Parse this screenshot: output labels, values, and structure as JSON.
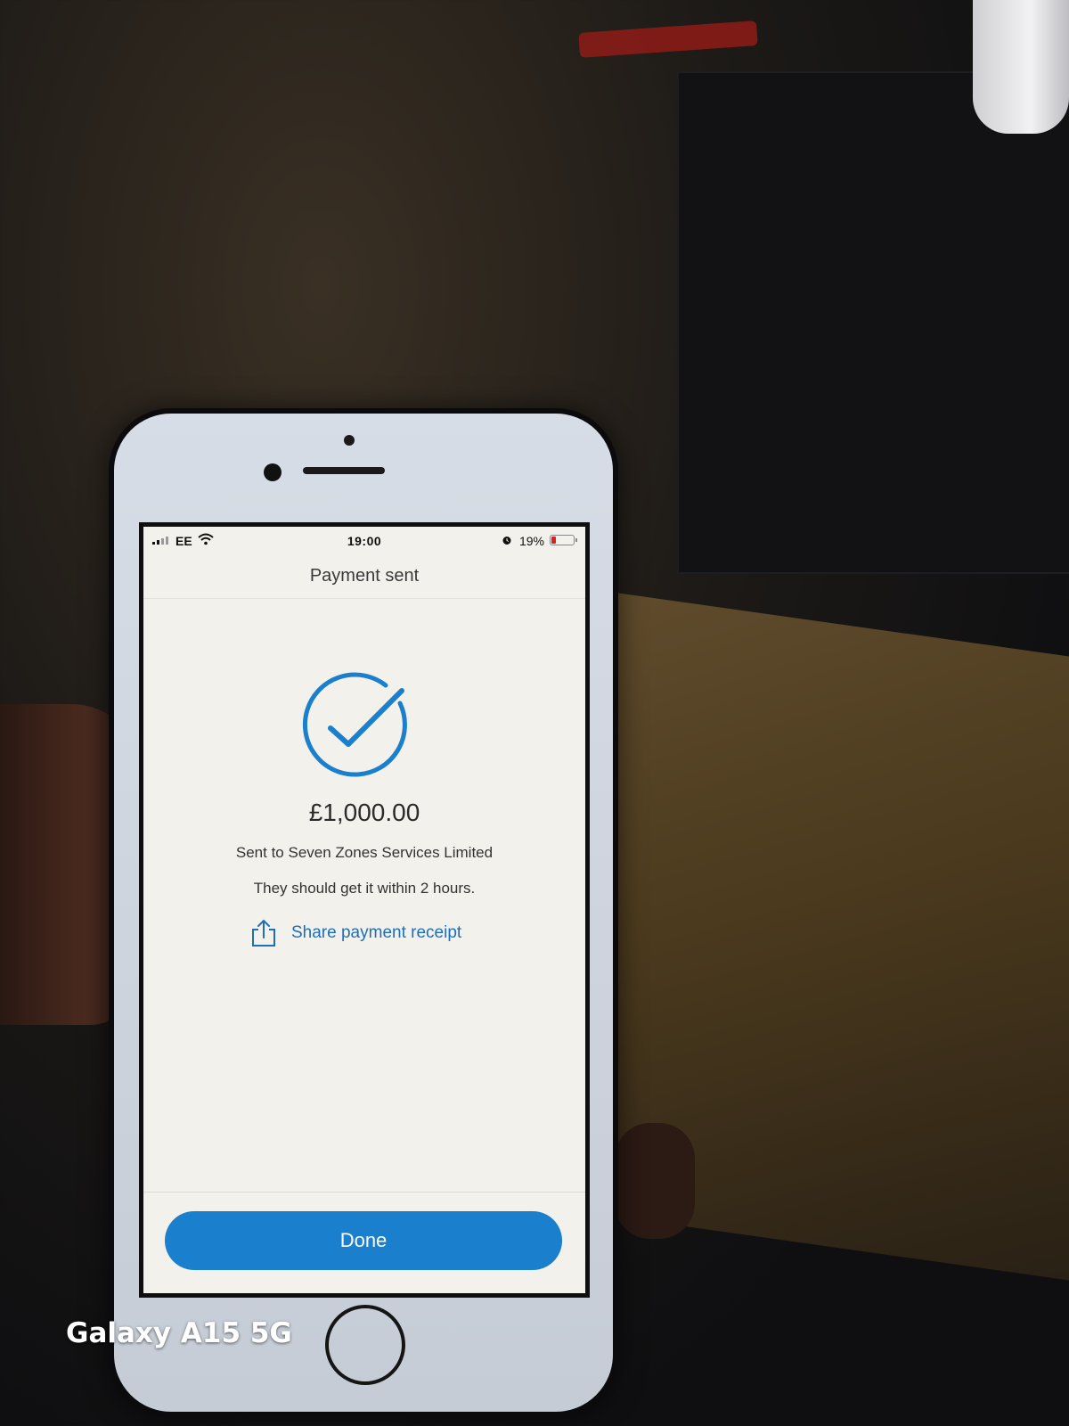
{
  "status_bar": {
    "carrier": "EE",
    "time": "19:00",
    "battery_percent_text": "19%",
    "battery_level": 0.19,
    "battery_color": "#e02020"
  },
  "nav": {
    "title": "Payment sent"
  },
  "confirmation": {
    "icon": "check-circle-icon",
    "accent_color": "#1a7fcc",
    "amount": "£1,000.00",
    "recipient_text": "Sent to Seven Zones Services Limited",
    "eta_text": "They should get it within 2 hours.",
    "share_label": "Share payment receipt",
    "share_icon": "share-icon"
  },
  "footer": {
    "done_label": "Done"
  },
  "device_watermark": "Galaxy A15 5G"
}
